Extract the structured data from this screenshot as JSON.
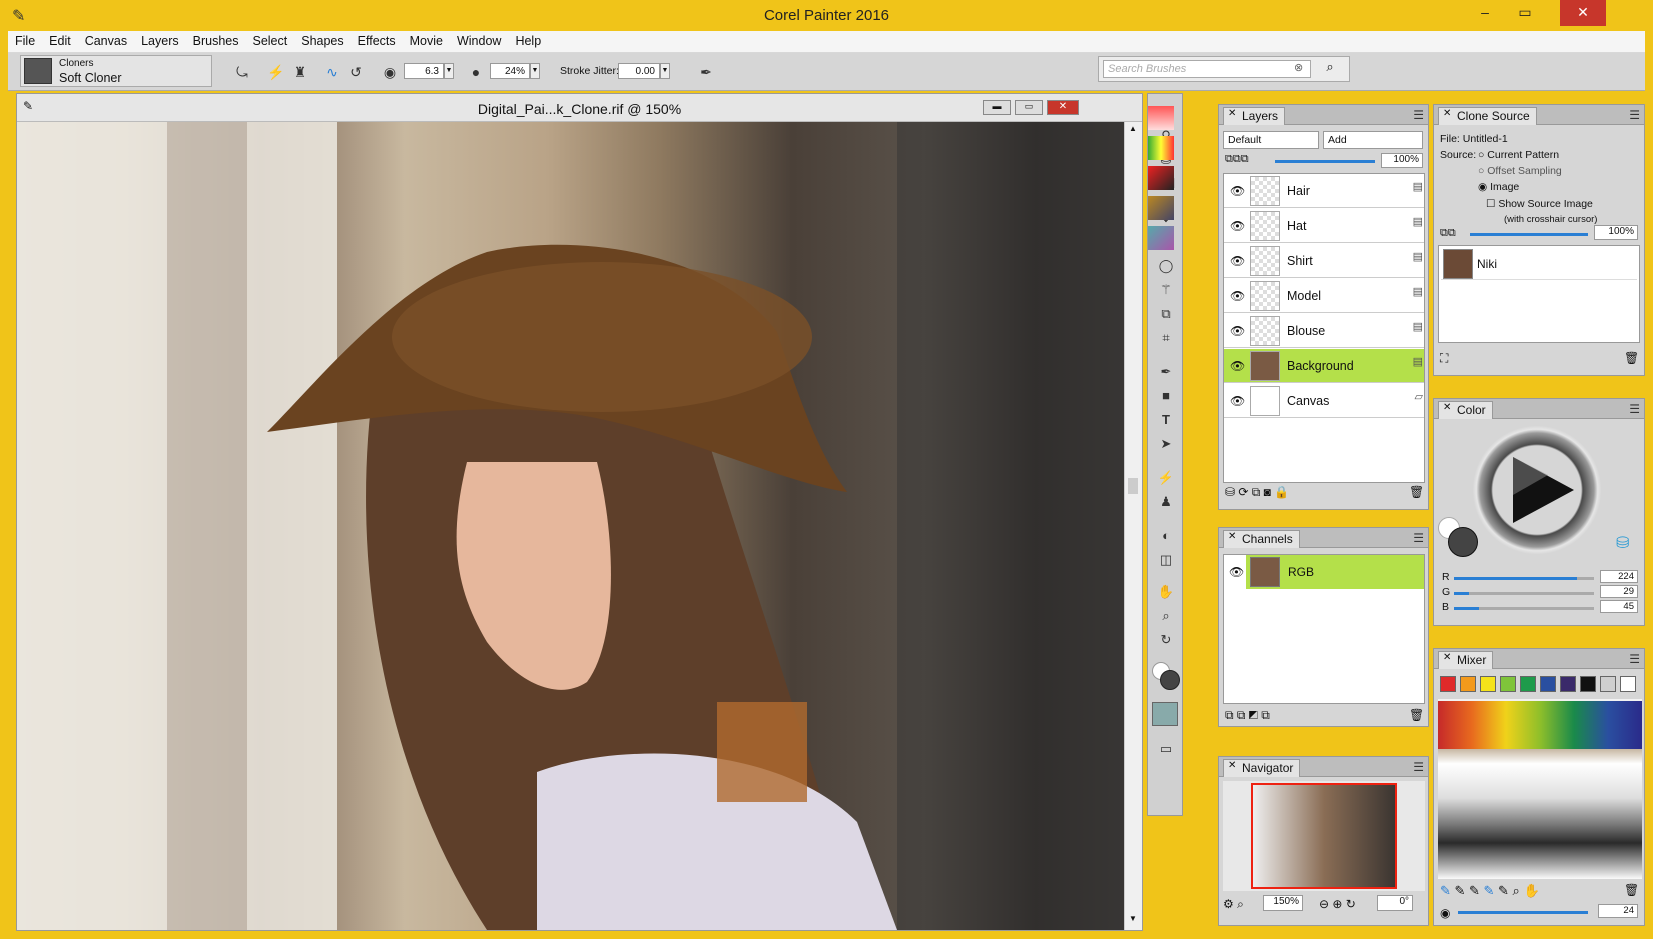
{
  "app": {
    "title": "Corel Painter 2016"
  },
  "menu": [
    "File",
    "Edit",
    "Canvas",
    "Layers",
    "Brushes",
    "Select",
    "Shapes",
    "Effects",
    "Movie",
    "Window",
    "Help"
  ],
  "propbar": {
    "category": "Cloners",
    "variant": "Soft Cloner",
    "size": "6.3",
    "opacity": "24%",
    "stroke_jitter_label": "Stroke Jitter:",
    "stroke_jitter": "0.00",
    "search_placeholder": "Search Brushes"
  },
  "document": {
    "title": "Digital_Pai...k_Clone.rif @ 150%"
  },
  "layers": {
    "tab": "Layers",
    "composite_method": "Default",
    "composite_depth": "Add",
    "opacity": "100%",
    "items": [
      {
        "name": "Hair",
        "selected": false
      },
      {
        "name": "Hat",
        "selected": false
      },
      {
        "name": "Shirt",
        "selected": false
      },
      {
        "name": "Model",
        "selected": false
      },
      {
        "name": "Blouse",
        "selected": false
      },
      {
        "name": "Background",
        "selected": true
      },
      {
        "name": "Canvas",
        "selected": false
      }
    ]
  },
  "channels": {
    "tab": "Channels",
    "item": "RGB"
  },
  "navigator": {
    "tab": "Navigator",
    "zoom": "150%",
    "rotation": "0°"
  },
  "clone_source": {
    "tab": "Clone Source",
    "file": "File: Untitled-1",
    "source_label": "Source:",
    "options": [
      "Current Pattern",
      "Offset Sampling",
      "Image"
    ],
    "selected": "Image",
    "show_source": "Show Source Image",
    "crosshair": "(with crosshair cursor)",
    "opacity": "100%",
    "source_item": "Niki"
  },
  "color": {
    "tab": "Color",
    "r_label": "R",
    "g_label": "G",
    "b_label": "B",
    "r": "224",
    "g": "29",
    "b": "45",
    "r_level": 0.88,
    "g_level": 0.11,
    "b_level": 0.18
  },
  "mixer": {
    "tab": "Mixer",
    "size": "24",
    "swatches": [
      "#e02a2a",
      "#f39a1c",
      "#f5e31a",
      "#7fc43a",
      "#1e9b4b",
      "#2a4fa0",
      "#3a2a6a",
      "#111111",
      "#cfcfcf",
      "#ffffff"
    ]
  }
}
